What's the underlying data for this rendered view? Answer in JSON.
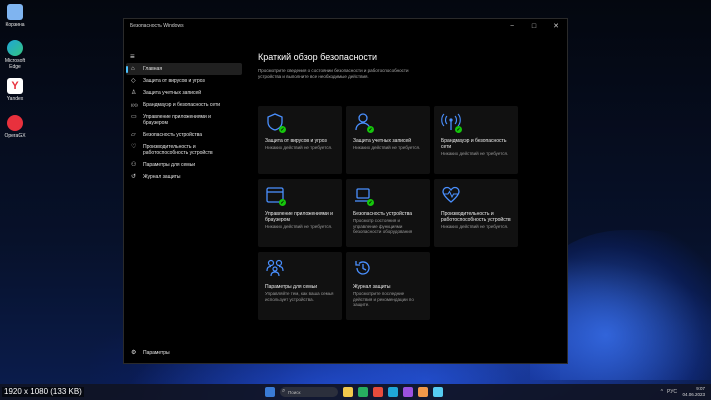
{
  "desktop": {
    "icons": [
      {
        "label": "Корзина",
        "color": "#7fb4f0"
      },
      {
        "label": "Microsoft Edge",
        "color": "#1fa6d8"
      },
      {
        "label": "Yandex",
        "color": "#f5d33a"
      },
      {
        "label": "OperaGX",
        "color": "#e8313d"
      }
    ]
  },
  "window": {
    "title": "Безопасность Windows",
    "controls": {
      "back": "←",
      "minimize": "−",
      "maximize": "□",
      "close": "✕"
    }
  },
  "sidebar": {
    "menu_icon": "≡",
    "items": [
      {
        "label": "Главная",
        "icon": "home-icon",
        "glyph": "⌂"
      },
      {
        "label": "Защита от вирусов и угроз",
        "icon": "shield-icon",
        "glyph": "◇"
      },
      {
        "label": "Защита учетных записей",
        "icon": "person-icon",
        "glyph": "♙"
      },
      {
        "label": "Брандмауэр и безопасность сети",
        "icon": "antenna-icon",
        "glyph": "((•))"
      },
      {
        "label": "Управление приложениями и\nбраузером",
        "icon": "app-browser-icon",
        "glyph": "▭"
      },
      {
        "label": "Безопасность устройства",
        "icon": "laptop-icon",
        "glyph": "▱"
      },
      {
        "label": "Производительность и\nработоспособность устройств",
        "icon": "heart-icon",
        "glyph": "♡"
      },
      {
        "label": "Параметры для семьи",
        "icon": "family-icon",
        "glyph": "⚇"
      },
      {
        "label": "Журнал защиты",
        "icon": "history-icon",
        "glyph": "↺"
      }
    ],
    "settings": {
      "label": "Параметры",
      "icon": "gear-icon",
      "glyph": "⚙"
    }
  },
  "main": {
    "title": "Краткий обзор безопасности",
    "description": "Просмотрите сведения о состоянии безопасности и работоспособности устройства и выполните все необходимые действия.",
    "cards": [
      {
        "title": "Защита от вирусов и угроз",
        "status": "Никаких действий не требуется.",
        "icon": "shield-icon",
        "check": true
      },
      {
        "title": "Защита учетных записей",
        "status": "Никаких действий не требуется.",
        "icon": "person-icon",
        "check": true
      },
      {
        "title": "Брандмауэр и безопасность сети",
        "status": "Никаких действий не требуется.",
        "icon": "antenna-icon",
        "check": true
      },
      {
        "title": "Управление приложениями и браузером",
        "status": "Никаких действий не требуется.",
        "icon": "app-browser-icon",
        "check": true
      },
      {
        "title": "Безопасность устройства",
        "status": "Просмотр состояния и управление функциями безопасности оборудования",
        "icon": "laptop-icon",
        "check": true
      },
      {
        "title": "Производительность и работоспособность устройств",
        "status": "Никаких действий не требуется.",
        "icon": "heart-icon",
        "check": false
      },
      {
        "title": "Параметры для семьи",
        "status": "Управляйте тем, как ваша семья использует устройства.",
        "icon": "family-icon",
        "check": false
      },
      {
        "title": "Журнал защиты",
        "status": "Просмотрите последние действия и рекомендации по защите.",
        "icon": "history-icon",
        "check": false
      }
    ]
  },
  "taskbar": {
    "search_placeholder": "Поиск",
    "tray": [
      "^",
      "РУС"
    ],
    "time": "9:07",
    "date": "04.06.2023",
    "apps": [
      "#3a7bd5",
      "#f2c94c",
      "#27ae60",
      "#e74c3c",
      "#1fa6d8",
      "#9b51e0",
      "#f2994a",
      "#56ccf2"
    ]
  },
  "caption": "1920 x 1080 (133 KB)",
  "accent": "#4cc2ff",
  "icon_color": "#4a90ff",
  "check_color": "#16c60c"
}
